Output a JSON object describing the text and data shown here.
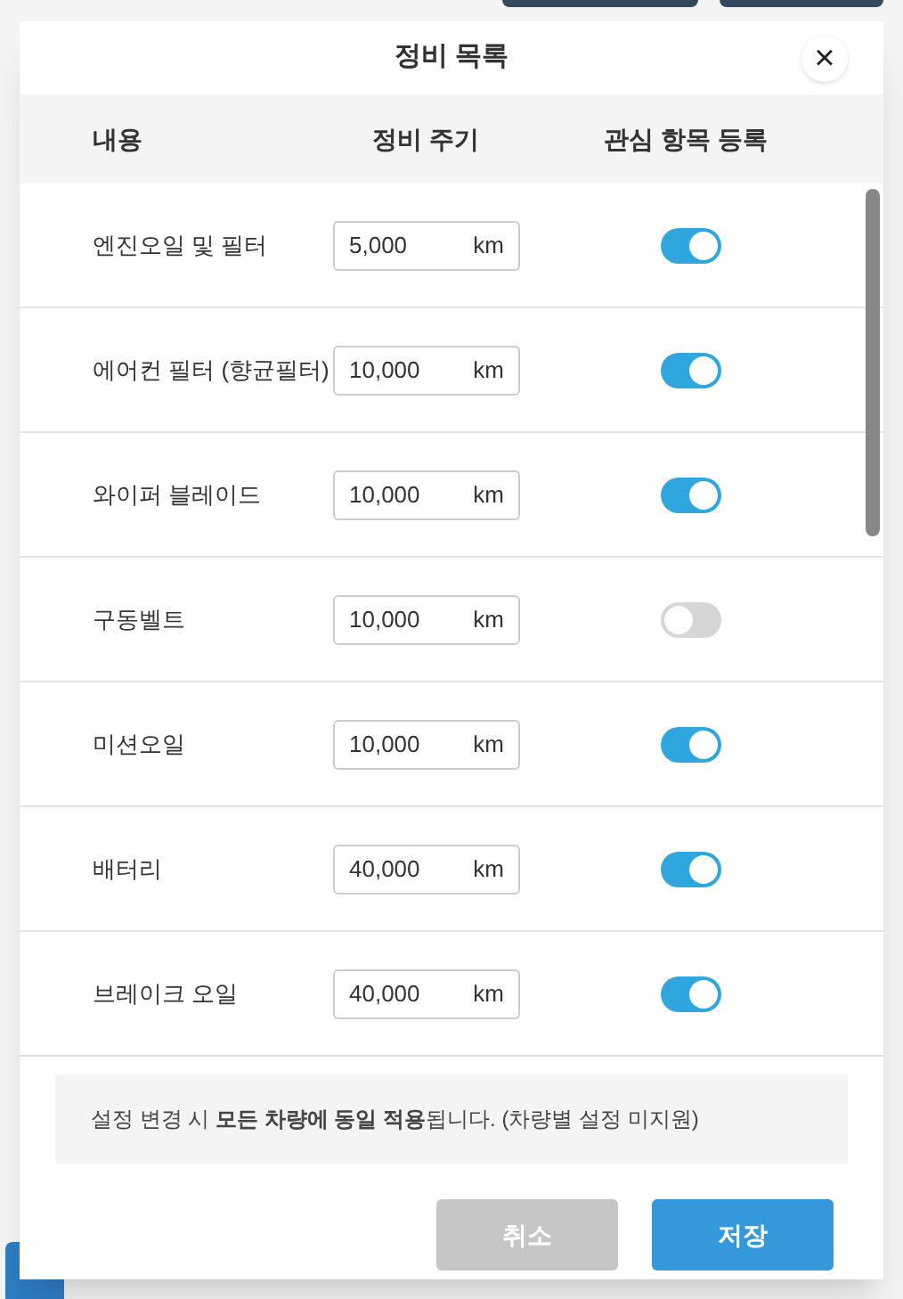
{
  "dialog": {
    "title": "정비 목록",
    "close": "×"
  },
  "columns": [
    "내용",
    "정비 주기",
    "관심 항목 등록"
  ],
  "rows": [
    {
      "name": "엔진오일 및 필터",
      "interval": "5,000",
      "unit": "km",
      "on": true
    },
    {
      "name": "에어컨 필터 (향균필터)",
      "interval": "10,000",
      "unit": "km",
      "on": true
    },
    {
      "name": "와이퍼 블레이드",
      "interval": "10,000",
      "unit": "km",
      "on": true
    },
    {
      "name": "구동벨트",
      "interval": "10,000",
      "unit": "km",
      "on": false
    },
    {
      "name": "미션오일",
      "interval": "10,000",
      "unit": "km",
      "on": true
    },
    {
      "name": "배터리",
      "interval": "40,000",
      "unit": "km",
      "on": true
    },
    {
      "name": "브레이크 오일",
      "interval": "40,000",
      "unit": "km",
      "on": true
    }
  ],
  "notice": "설정 변경 시 **모든 차량에 동일 적용**됩니다. (차량별 설정 미지원)",
  "buttons": [
    {
      "label": "취소",
      "kind": "cancel"
    },
    {
      "label": "저장",
      "kind": "save"
    }
  ]
}
